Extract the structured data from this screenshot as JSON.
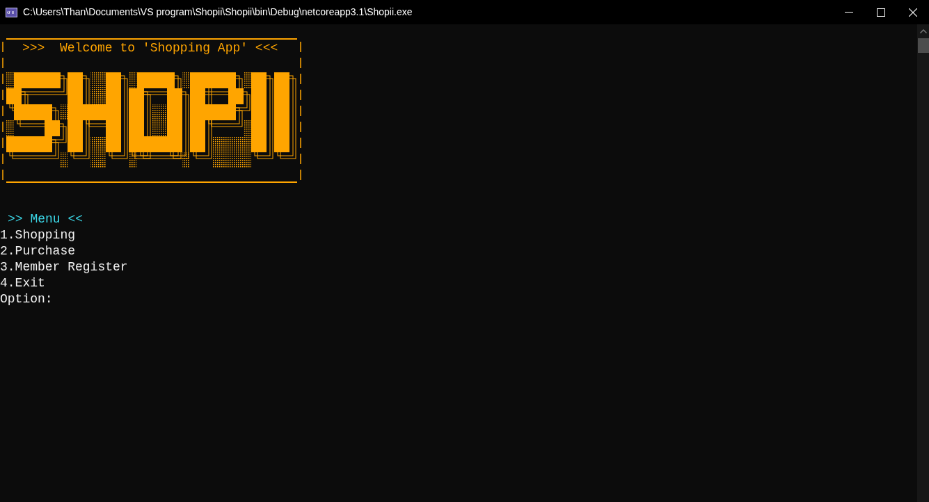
{
  "window": {
    "title": "C:\\Users\\Than\\Documents\\VS program\\Shopii\\Shopii\\bin\\Debug\\netcoreapp3.1\\Shopii.exe"
  },
  "console": {
    "banner": {
      "heading": ">>>  Welcome to 'Shopping App' <<<"
    },
    "menu_title": ">> Menu <<",
    "menu_items": [
      "1.Shopping",
      "2.Purchase",
      "3.Member Register",
      "4.Exit"
    ],
    "prompt": "Option:"
  }
}
